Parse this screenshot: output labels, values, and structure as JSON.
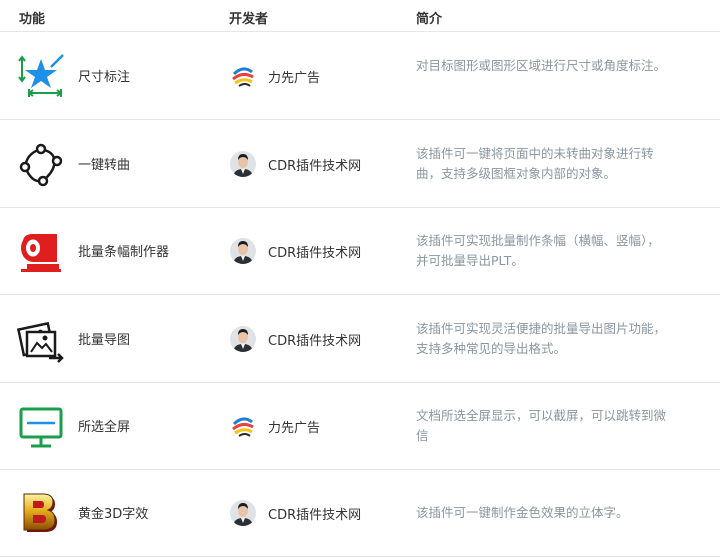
{
  "header": {
    "col_function": "功能",
    "col_developer": "开发者",
    "col_intro": "简介"
  },
  "rows": [
    {
      "name": "尺寸标注",
      "icon": "dimension-star-icon",
      "developer": "力先广告",
      "developer_logo": "lixian-logo",
      "desc": "对目标图形或图形区域进行尺寸或角度标注。"
    },
    {
      "name": "一键转曲",
      "icon": "curve-nodes-icon",
      "developer": "CDR插件技术网",
      "developer_logo": "person-avatar",
      "desc": "该插件可一键将页面中的未转曲对象进行转曲，支持多级图框对象内部的对象。"
    },
    {
      "name": "批量条幅制作器",
      "icon": "banner-roll-icon",
      "developer": "CDR插件技术网",
      "developer_logo": "person-avatar",
      "desc": "该插件可实现批量制作条幅（横幅、竖幅），并可批量导出PLT。"
    },
    {
      "name": "批量导图",
      "icon": "image-export-icon",
      "developer": "CDR插件技术网",
      "developer_logo": "person-avatar",
      "desc": "该插件可实现灵活便捷的批量导出图片功能，支持多种常见的导出格式。"
    },
    {
      "name": "所选全屏",
      "icon": "monitor-icon",
      "developer": "力先广告",
      "developer_logo": "lixian-logo",
      "desc": "文档所选全屏显示，可以截屏，可以跳转到微信"
    },
    {
      "name": "黄金3D字效",
      "icon": "gold-3d-letter-icon",
      "developer": "CDR插件技术网",
      "developer_logo": "person-avatar",
      "desc": "该插件可一键制作金色效果的立体字。"
    }
  ]
}
